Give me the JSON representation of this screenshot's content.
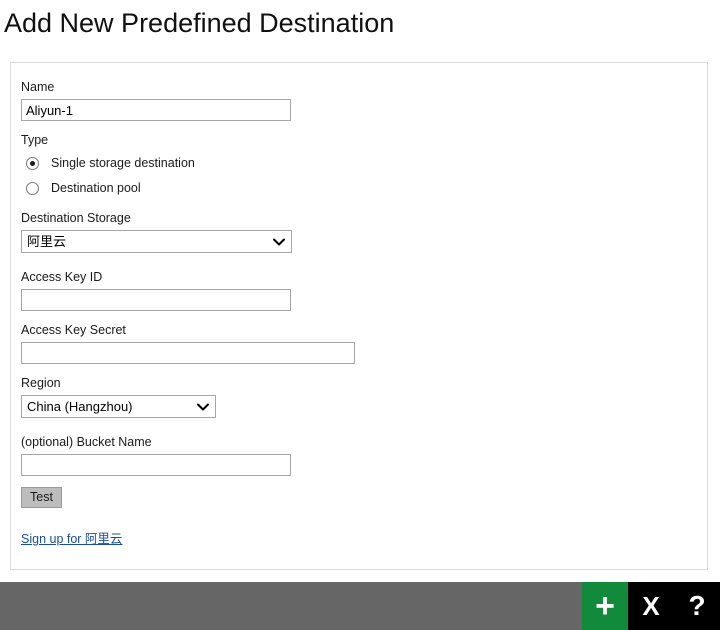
{
  "page": {
    "title": "Add New Predefined Destination"
  },
  "form": {
    "name": {
      "label": "Name",
      "value": "Aliyun-1",
      "placeholder": ""
    },
    "type": {
      "label": "Type",
      "options": [
        {
          "label": "Single storage destination",
          "selected": true
        },
        {
          "label": "Destination pool",
          "selected": false
        }
      ]
    },
    "destination_storage": {
      "label": "Destination Storage",
      "value": "阿里云"
    },
    "access_key_id": {
      "label": "Access Key ID",
      "value": "",
      "placeholder": ""
    },
    "access_key_secret": {
      "label": "Access Key Secret",
      "value": "",
      "placeholder": ""
    },
    "region": {
      "label": "Region",
      "value": "China (Hangzhou)"
    },
    "bucket_name": {
      "label": "(optional) Bucket Name",
      "value": "",
      "placeholder": ""
    },
    "test_button_label": "Test",
    "signup_link_label": "Sign up for 阿里云"
  },
  "toolbar": {
    "add_label": "+",
    "close_label": "X",
    "help_label": "?",
    "background_color": "#666666",
    "add_color": "#128a3c",
    "button_color": "#000000"
  }
}
